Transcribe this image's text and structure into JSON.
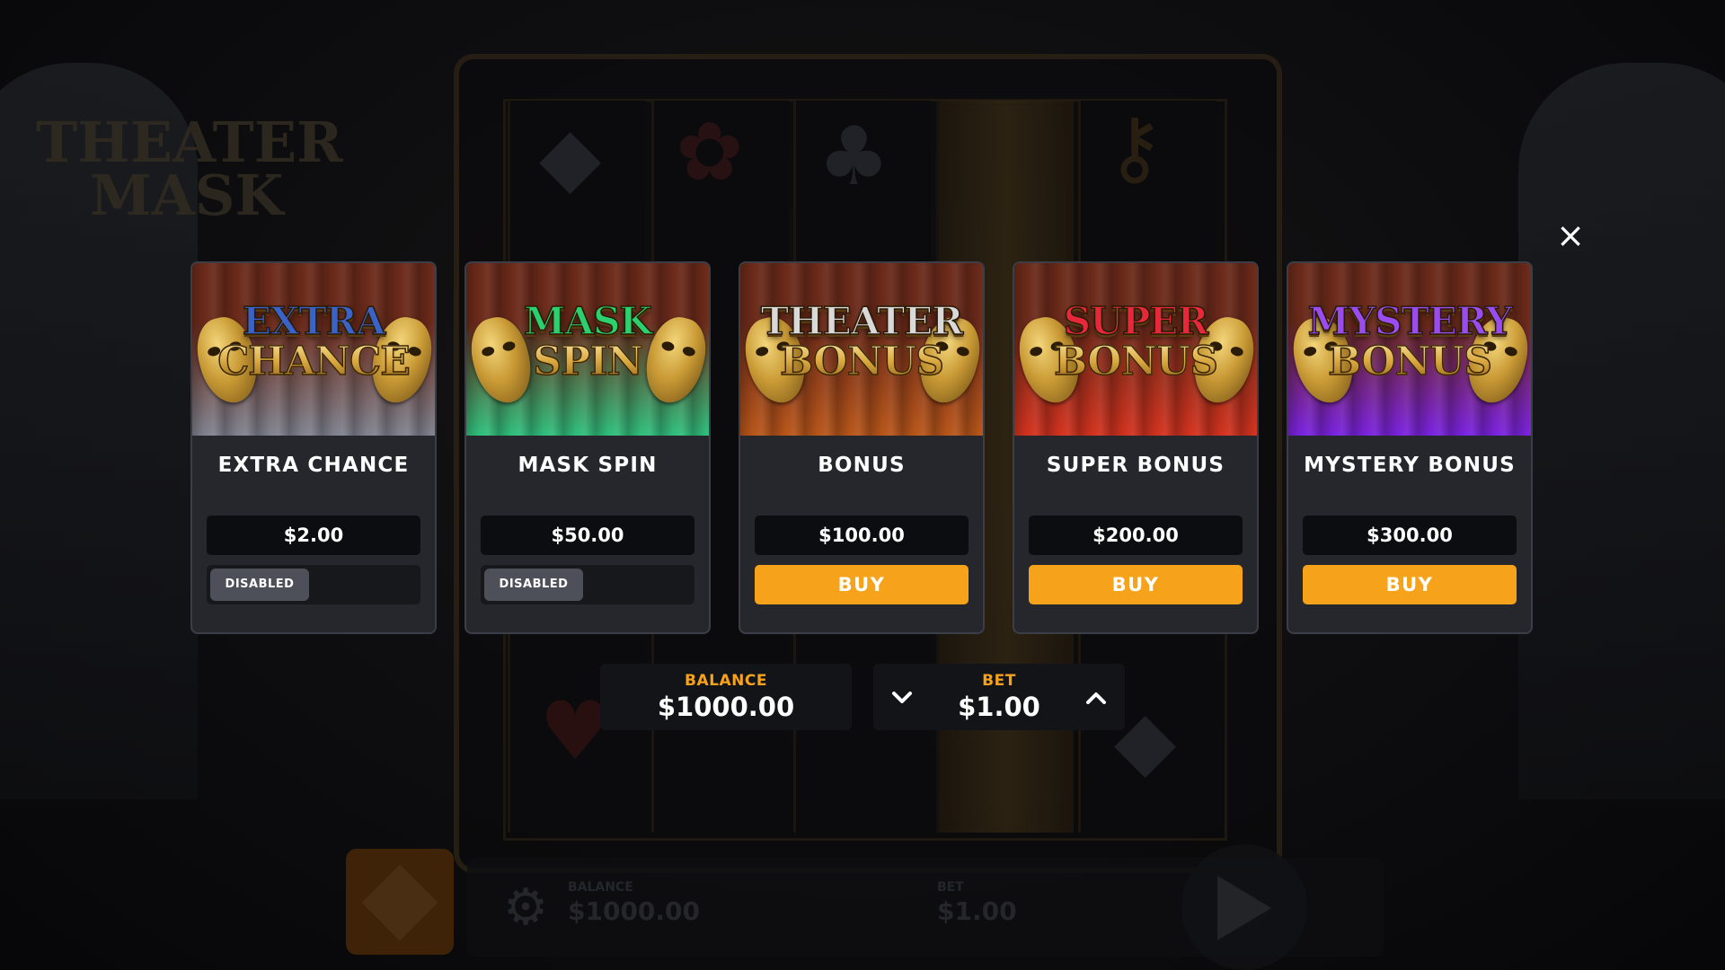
{
  "game": {
    "logo_line1": "THEATER",
    "logo_line2": "MASK"
  },
  "background_bar": {
    "balance_label": "BALANCE",
    "balance_value": "$1000.00",
    "bet_label": "BET",
    "bet_value": "$1.00"
  },
  "modal": {
    "close_icon": "×",
    "cards": [
      {
        "logo_line1": "EXTRA",
        "logo_line2": "CHANCE",
        "logo_color": "#3a63c9",
        "bg_top": "#6b2a1a",
        "bg_bottom": "#7f8390",
        "title": "EXTRA CHANCE",
        "price": "$2.00",
        "action": "disabled",
        "action_label": "DISABLED"
      },
      {
        "logo_line1": "MASK",
        "logo_line2": "SPIN",
        "logo_color": "#2bd16e",
        "bg_top": "#6b2a1a",
        "bg_bottom": "#2fbf7d",
        "title": "MASK SPIN",
        "price": "$50.00",
        "action": "disabled",
        "action_label": "DISABLED"
      },
      {
        "logo_line1": "THEATER",
        "logo_line2": "BONUS",
        "logo_color": "#d9d9d9",
        "bg_top": "#6b2a1a",
        "bg_bottom": "#b8561a",
        "title": "BONUS",
        "price": "$100.00",
        "action": "buy",
        "action_label": "BUY"
      },
      {
        "logo_line1": "SUPER",
        "logo_line2": "BONUS",
        "logo_color": "#e8283a",
        "bg_top": "#6b2a1a",
        "bg_bottom": "#d2321e",
        "title": "SUPER BONUS",
        "price": "$200.00",
        "action": "buy",
        "action_label": "BUY"
      },
      {
        "logo_line1": "MYSTERY",
        "logo_line2": "BONUS",
        "logo_color": "#9b4cf0",
        "bg_top": "#6b2a1a",
        "bg_bottom": "#7a22e0",
        "title": "MYSTERY BONUS",
        "price": "$300.00",
        "action": "buy",
        "action_label": "BUY"
      }
    ],
    "balance": {
      "label": "BALANCE",
      "value": "$1000.00"
    },
    "bet": {
      "label": "BET",
      "value": "$1.00",
      "decrease_icon": "chevron-down-icon",
      "increase_icon": "chevron-up-icon"
    }
  },
  "colors": {
    "accent": "#f7a21b",
    "card_bg": "#25272d",
    "price_bg": "#0c0d10",
    "disabled_pill": "#4d5059"
  }
}
